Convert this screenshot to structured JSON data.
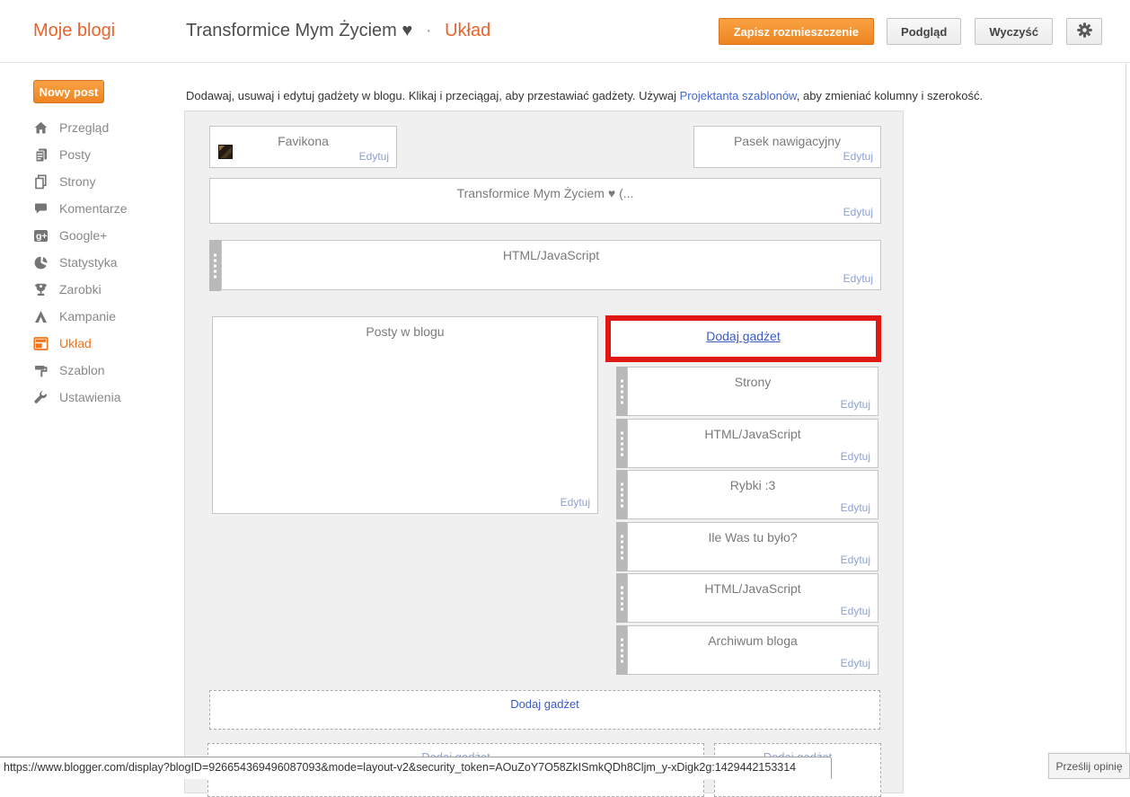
{
  "header": {
    "brand": "Moje blogi",
    "blog_title": "Transformice Mym Życiem ♥",
    "separator": "·",
    "page_name": "Układ",
    "buttons": {
      "save": "Zapisz rozmieszczenie",
      "preview": "Podgląd",
      "clear": "Wyczyść",
      "settings_icon": "gear-icon"
    }
  },
  "sidebar": {
    "new_post_label": "Nowy post",
    "items": [
      {
        "label": "Przegląd",
        "icon": "home-icon",
        "active": false
      },
      {
        "label": "Posty",
        "icon": "posts-icon",
        "active": false
      },
      {
        "label": "Strony",
        "icon": "pages-icon",
        "active": false
      },
      {
        "label": "Komentarze",
        "icon": "comments-icon",
        "active": false
      },
      {
        "label": "Google+",
        "icon": "googleplus-icon",
        "active": false
      },
      {
        "label": "Statystyka",
        "icon": "stats-icon",
        "active": false
      },
      {
        "label": "Zarobki",
        "icon": "earnings-icon",
        "active": false
      },
      {
        "label": "Kampanie",
        "icon": "campaigns-icon",
        "active": false
      },
      {
        "label": "Układ",
        "icon": "layout-icon",
        "active": true
      },
      {
        "label": "Szablon",
        "icon": "template-icon",
        "active": false
      },
      {
        "label": "Ustawienia",
        "icon": "settings-icon",
        "active": false
      }
    ]
  },
  "main": {
    "intro": {
      "text_before": "Dodawaj, usuwaj i edytuj gadżety w blogu. Klikaj i przeciągaj, aby przestawiać gadżety. Używaj ",
      "link": "Projektanta szablonów",
      "text_after": ", aby zmieniać kolumny i szerokość."
    },
    "edit_label": "Edytuj",
    "add_gadget_label": "Dodaj gadżet",
    "gadgets": {
      "favicon": "Favikona",
      "navbar": "Pasek nawigacyjny",
      "blog_header": "Transformice Mym Życiem ♥ (...",
      "html_top": "HTML/JavaScript",
      "blog_posts": "Posty w blogu",
      "sidebar_gadgets": [
        {
          "title": "Strony"
        },
        {
          "title": "HTML/JavaScript"
        },
        {
          "title": "Rybki :3"
        },
        {
          "title": "Ile Was tu było?"
        },
        {
          "title": "HTML/JavaScript"
        },
        {
          "title": "Archiwum bloga"
        }
      ]
    }
  },
  "statusbar": {
    "url": "https://www.blogger.com/display?blogID=926654369496087093&mode=layout-v2&security_token=AOuZoY7O58ZkISmkQDh8Cljm_y-xDigk2g:1429442153314"
  },
  "feedback_label": "Prześlij opinię",
  "colors": {
    "accent_orange": "#f0751f",
    "highlight_red": "#e01715",
    "link_blue": "#4469cf",
    "edit_link_blue": "#8da0d6"
  }
}
